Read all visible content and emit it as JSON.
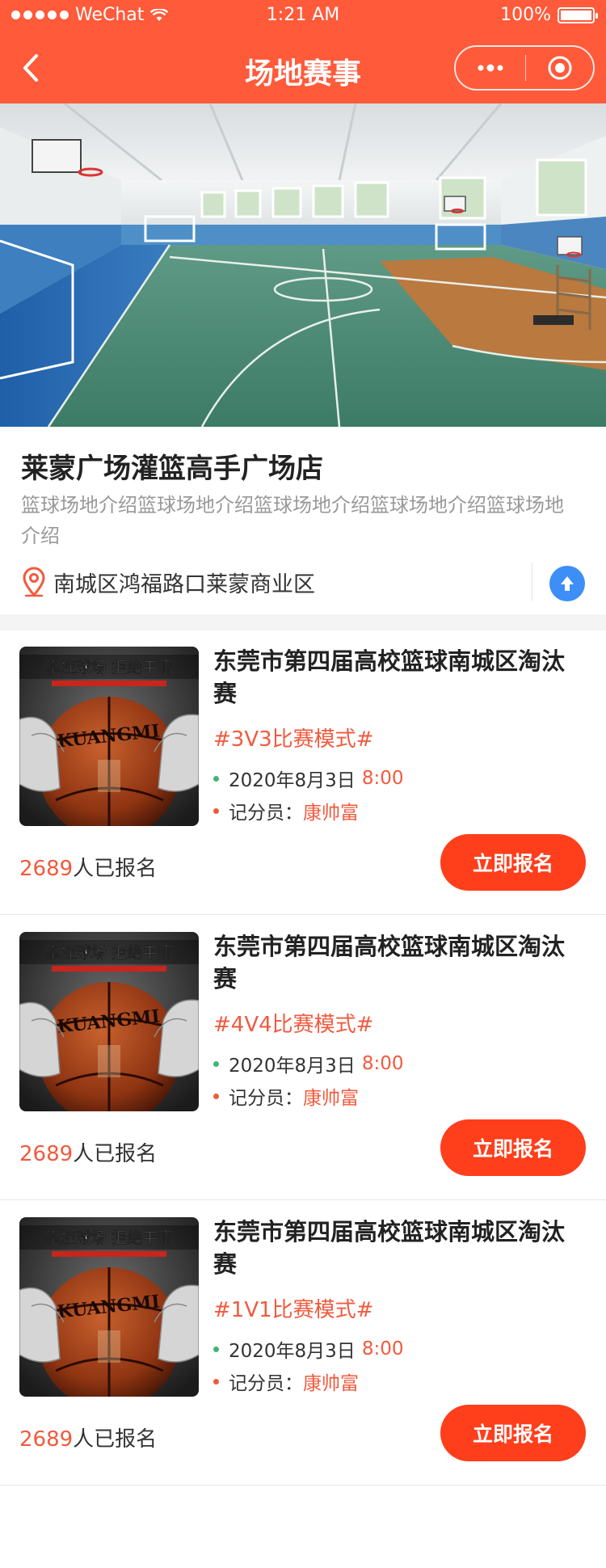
{
  "status_bar": {
    "carrier": "WeChat",
    "time": "1:21 AM",
    "battery": "100%"
  },
  "nav": {
    "title": "场地赛事"
  },
  "venue": {
    "name": "莱蒙广场灌篮高手广场店",
    "description": "篮球场地介绍篮球场地介绍篮球场地介绍篮球场地介绍篮球场地介绍",
    "address": "南城区鸿福路口莱蒙商业区"
  },
  "colors": {
    "primary": "#ff5a3a",
    "accent": "#f25a3e",
    "button": "#ff3e1c",
    "nav_blue": "#3d8ef7"
  },
  "events": [
    {
      "title": "东莞市第四届高校篮球南城区淘汰赛",
      "mode": "#3V3比赛模式#",
      "date": "2020年8月3日",
      "time": "8:00",
      "referee_label": "记分员：",
      "referee": "康帅富",
      "count": "2689",
      "count_suffix": "人已报名",
      "button": "立即报名",
      "poster_headline": "掌控球场 拒绝平庸",
      "poster_brand": "KUANGMI"
    },
    {
      "title": "东莞市第四届高校篮球南城区淘汰赛",
      "mode": "#4V4比赛模式#",
      "date": "2020年8月3日",
      "time": "8:00",
      "referee_label": "记分员：",
      "referee": "康帅富",
      "count": "2689",
      "count_suffix": "人已报名",
      "button": "立即报名",
      "poster_headline": "掌控球场 拒绝平庸",
      "poster_brand": "KUANGMI"
    },
    {
      "title": "东莞市第四届高校篮球南城区淘汰赛",
      "mode": "#1V1比赛模式#",
      "date": "2020年8月3日",
      "time": "8:00",
      "referee_label": "记分员：",
      "referee": "康帅富",
      "count": "2689",
      "count_suffix": "人已报名",
      "button": "立即报名",
      "poster_headline": "掌控球场 拒绝平庸",
      "poster_brand": "KUANGMI"
    }
  ]
}
